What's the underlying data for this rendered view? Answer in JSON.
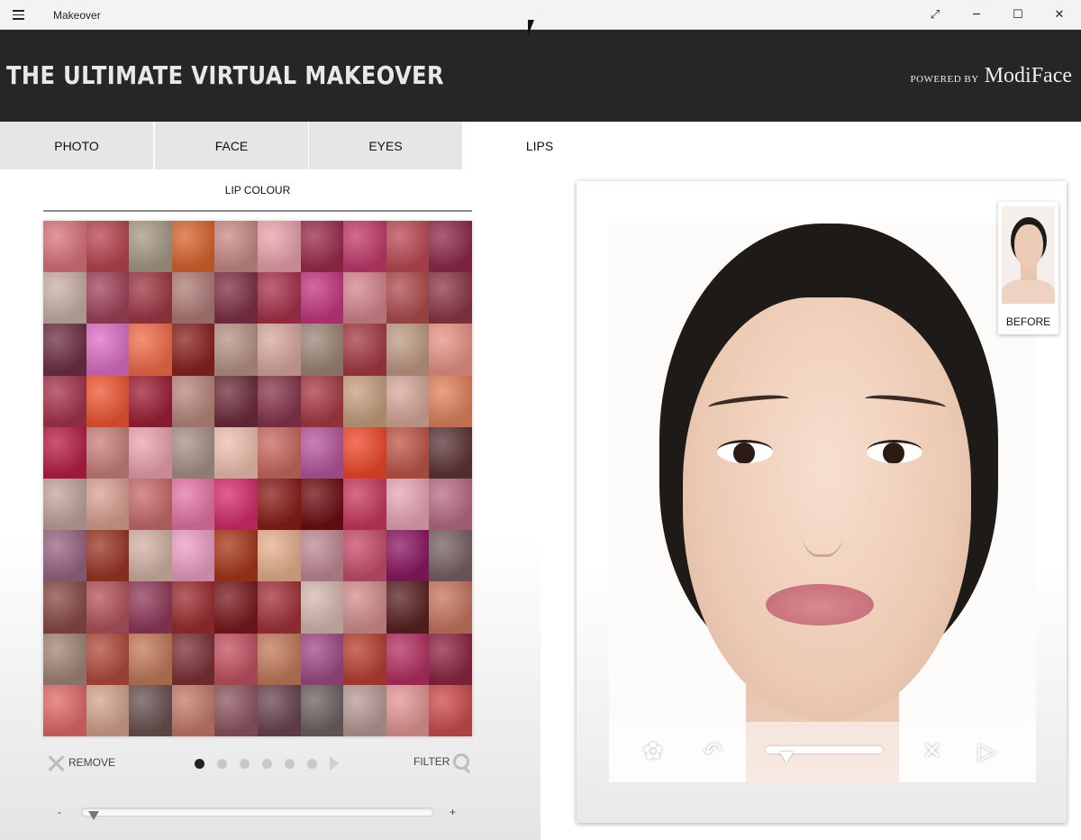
{
  "window": {
    "title": "Makeover",
    "controls": [
      "expand",
      "minimize",
      "maximize",
      "close"
    ]
  },
  "banner": {
    "brand": "THE ULTIMATE VIRTUAL MAKEOVER",
    "powered_small": "POWERED BY",
    "powered_big": "ModiFace"
  },
  "tabs": [
    {
      "label": "PHOTO",
      "active": false
    },
    {
      "label": "FACE",
      "active": false
    },
    {
      "label": "EYES",
      "active": false
    },
    {
      "label": "LIPS",
      "active": true
    }
  ],
  "lip_panel": {
    "title": "LIP COLOUR",
    "remove_label": "REMOVE",
    "filter_label": "FILTER",
    "pages": 6,
    "current_page": 1,
    "intensity_minus": "-",
    "intensity_plus": "+",
    "intensity_value": 0.02,
    "swatches": [
      "#d9737e",
      "#b8454f",
      "#a89a86",
      "#d8652f",
      "#c88a85",
      "#e9a3ab",
      "#9b2c4e",
      "#c23b6a",
      "#bc4a55",
      "#8e2a4b",
      "#c9b1a8",
      "#a0445a",
      "#9f3845",
      "#b07d78",
      "#7f3147",
      "#a8324a",
      "#c43781",
      "#d4868e",
      "#b04d4f",
      "#8d3848",
      "#6f3042",
      "#dc70c6",
      "#f26c49",
      "#8a2320",
      "#b89387",
      "#d8a9a0",
      "#a08679",
      "#a63b45",
      "#c09b85",
      "#e89386",
      "#a6344d",
      "#ef5733",
      "#9e1f36",
      "#b9877d",
      "#6e2d3a",
      "#88364d",
      "#a83a45",
      "#c7a07f",
      "#d8a89a",
      "#e2825e",
      "#b81f48",
      "#c98079",
      "#eba3b0",
      "#a89288",
      "#efc0ae",
      "#c96960",
      "#b7579c",
      "#f0482b",
      "#c05648",
      "#5e3537",
      "#c2a59b",
      "#d9a192",
      "#c86b6b",
      "#e575a6",
      "#d52d6b",
      "#8a1d19",
      "#6d0f12",
      "#c93b5c",
      "#e7a6b4",
      "#b96c84",
      "#9a6583",
      "#9c3626",
      "#d3b2a6",
      "#ec9fc3",
      "#a8371a",
      "#e8b08e",
      "#c08a95",
      "#c84d6b",
      "#8c1762",
      "#786264",
      "#8a4a45",
      "#b3535c",
      "#91395a",
      "#9c2d30",
      "#7a1a1d",
      "#a3323a",
      "#d7b9b1",
      "#d48e8e",
      "#5a2222",
      "#c87660",
      "#a48678",
      "#b14b3c",
      "#c37a58",
      "#7d3237",
      "#c25261",
      "#c47a5c",
      "#a04b87",
      "#b84032",
      "#b43061",
      "#8e2544",
      "#e06a67",
      "#d4a38e",
      "#6b5151",
      "#c47b6a",
      "#8e5660",
      "#6c4454",
      "#6e6262",
      "#b89a96",
      "#e29694",
      "#cd4c4c"
    ]
  },
  "photo_panel": {
    "before_label": "BEFORE",
    "slider_value": 0.18,
    "toolbar": [
      "palette-icon",
      "undo-icon",
      "close-icon",
      "share-icon"
    ]
  }
}
